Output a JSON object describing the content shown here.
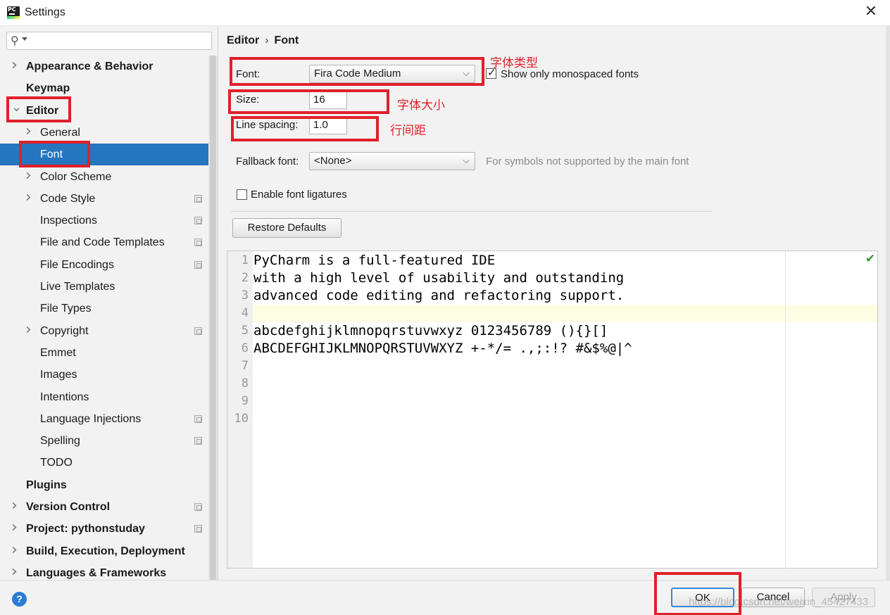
{
  "window": {
    "title": "Settings",
    "app_icon_text": "PC"
  },
  "search": {
    "value": "",
    "placeholder": ""
  },
  "sidebar": {
    "items": [
      {
        "label": "Appearance & Behavior",
        "bold": true,
        "arrow": "right"
      },
      {
        "label": "Keymap",
        "bold": true
      },
      {
        "label": "Editor",
        "bold": true,
        "arrow": "down"
      },
      {
        "label": "General",
        "arrow": "right"
      },
      {
        "label": "Font",
        "selected": true
      },
      {
        "label": "Color Scheme",
        "arrow": "right"
      },
      {
        "label": "Code Style",
        "arrow": "right",
        "copy": true
      },
      {
        "label": "Inspections",
        "copy": true
      },
      {
        "label": "File and Code Templates",
        "copy": true
      },
      {
        "label": "File Encodings",
        "copy": true
      },
      {
        "label": "Live Templates"
      },
      {
        "label": "File Types"
      },
      {
        "label": "Copyright",
        "arrow": "right",
        "copy": true
      },
      {
        "label": "Emmet"
      },
      {
        "label": "Images"
      },
      {
        "label": "Intentions"
      },
      {
        "label": "Language Injections",
        "copy": true
      },
      {
        "label": "Spelling",
        "copy": true
      },
      {
        "label": "TODO"
      },
      {
        "label": "Plugins",
        "bold": true
      },
      {
        "label": "Version Control",
        "bold": true,
        "arrow": "right",
        "copy": true
      },
      {
        "label": "Project: pythonstuday",
        "bold": true,
        "arrow": "right",
        "copy": true
      },
      {
        "label": "Build, Execution, Deployment",
        "bold": true,
        "arrow": "right"
      },
      {
        "label": "Languages & Frameworks",
        "bold": true,
        "arrow": "right"
      }
    ]
  },
  "breadcrumb": {
    "parent": "Editor",
    "separator": "›",
    "current": "Font"
  },
  "font": {
    "font_label": "Font:",
    "font_value": "Fira Code Medium",
    "monospaced_label": "Show only monospaced fonts",
    "monospaced_checked": true,
    "size_label": "Size:",
    "size_value": "16",
    "line_spacing_label": "Line spacing:",
    "line_spacing_value": "1.0",
    "fallback_label": "Fallback font:",
    "fallback_value": "<None>",
    "fallback_hint": "For symbols not supported by the main font",
    "ligatures_label": "Enable font ligatures",
    "ligatures_checked": false,
    "restore_label": "Restore Defaults"
  },
  "annotations": {
    "font_type": "字体类型",
    "font_size": "字体大小",
    "line_spacing": "行间距"
  },
  "preview": {
    "lines": [
      "PyCharm is a full-featured IDE",
      "with a high level of usability and outstanding",
      "advanced code editing and refactoring support.",
      "",
      "abcdefghijklmnopqrstuvwxyz 0123456789 (){}[]",
      "ABCDEFGHIJKLMNOPQRSTUVWXYZ +-*/= .,;:!? #&$%@|^",
      "",
      "",
      "",
      ""
    ],
    "line_numbers": [
      "1",
      "2",
      "3",
      "4",
      "5",
      "6",
      "7",
      "8",
      "9",
      "10"
    ],
    "current_line_index": 3
  },
  "footer": {
    "help_label": "?",
    "ok_label": "OK",
    "cancel_label": "Cancel",
    "apply_label": "Apply",
    "watermark": "https://blog.csdn.net/weixin_45427433"
  },
  "colors": {
    "selection": "#2675bf",
    "annotation_red": "#e0202a",
    "current_line": "#fdfde4",
    "help_blue": "#2b7bd6"
  }
}
